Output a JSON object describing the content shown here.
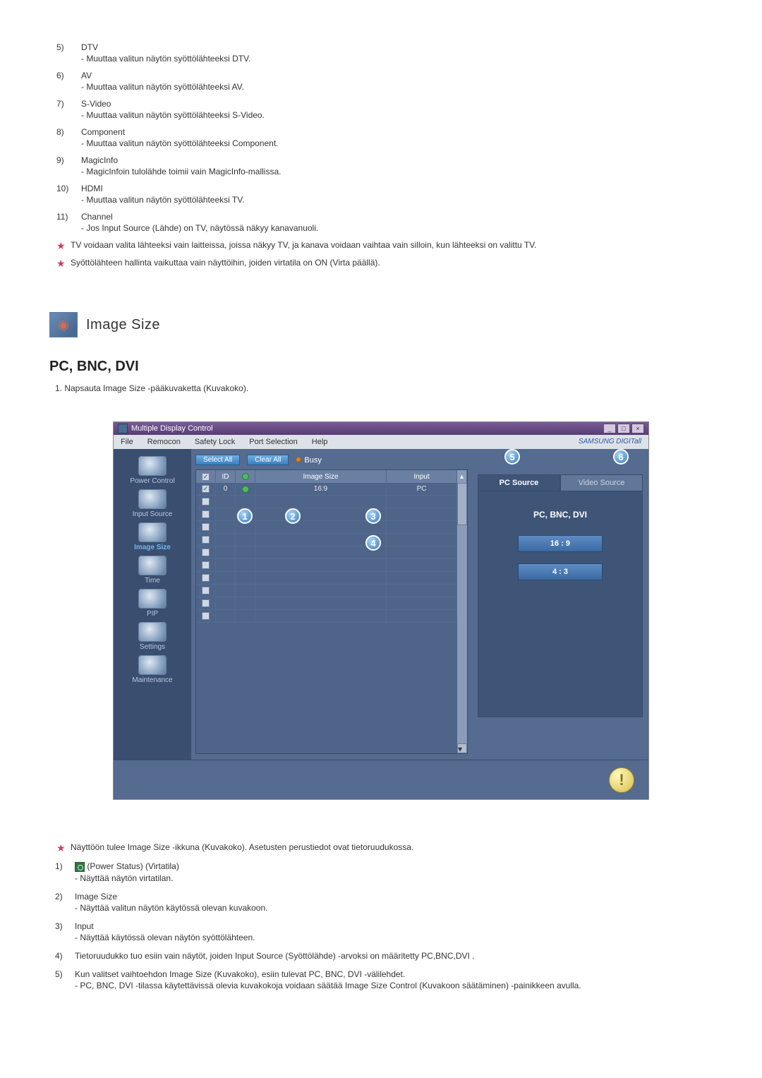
{
  "top_list": [
    {
      "num": "5)",
      "title": "DTV",
      "desc": [
        "- Muuttaa valitun näytön syöttölähteeksi DTV."
      ]
    },
    {
      "num": "6)",
      "title": "AV",
      "desc": [
        "- Muuttaa valitun näytön syöttölähteeksi AV."
      ]
    },
    {
      "num": "7)",
      "title": "S-Video",
      "desc": [
        "- Muuttaa valitun näytön syöttölähteeksi S-Video."
      ]
    },
    {
      "num": "8)",
      "title": "Component",
      "desc": [
        "- Muuttaa valitun näytön syöttölähteeksi Component."
      ]
    },
    {
      "num": "9)",
      "title": "MagicInfo",
      "desc": [
        "- MagicInfoin tulolähde toimii vain MagicInfo-mallissa."
      ]
    },
    {
      "num": "10)",
      "title": "HDMI",
      "desc": [
        "- Muuttaa valitun näytön syöttölähteeksi TV."
      ]
    },
    {
      "num": "11)",
      "title": "Channel",
      "desc": [
        "- Jos Input Source (Lähde) on TV, näytössä näkyy kanavanuoli."
      ]
    }
  ],
  "star_notes_top": [
    "TV voidaan valita lähteeksi vain laitteissa, joissa näkyy TV, ja kanava voidaan vaihtaa vain silloin, kun lähteeksi on valittu TV.",
    "Syöttölähteen hallinta vaikuttaa vain näyttöihin, joiden virtatila on ON (Virta päällä)."
  ],
  "section_title": "Image Size",
  "sub_title": "PC, BNC, DVI",
  "sub_instruction": "1. Napsauta Image Size -pääkuvaketta (Kuvakoko).",
  "app": {
    "title": "Multiple Display Control",
    "menu": [
      "File",
      "Remocon",
      "Safety Lock",
      "Port Selection",
      "Help"
    ],
    "brand": "SAMSUNG DIGITall",
    "sidebar": [
      {
        "label": "Power Control"
      },
      {
        "label": "Input Source"
      },
      {
        "label": "Image Size"
      },
      {
        "label": "Time"
      },
      {
        "label": "PIP"
      },
      {
        "label": "Settings"
      },
      {
        "label": "Maintenance"
      }
    ],
    "buttons": {
      "select_all": "Select All",
      "clear_all": "Clear All",
      "busy": "Busy"
    },
    "grid": {
      "headers": {
        "chk": "✓",
        "id": "ID",
        "st": "",
        "size": "Image Size",
        "input": "Input"
      },
      "row": {
        "id": "0",
        "size": "16:9",
        "input": "PC"
      }
    },
    "right": {
      "tab_pc": "PC Source",
      "tab_video": "Video Source",
      "panel_label": "PC, BNC, DVI",
      "ratios": [
        "16 : 9",
        "4 : 3"
      ]
    },
    "markers": {
      "m1": "1",
      "m2": "2",
      "m3": "3",
      "m4": "4",
      "m5": "5",
      "m6": "6"
    }
  },
  "star_notes_mid": [
    "Näyttöön tulee Image Size -ikkuna (Kuvakoko). Asetusten perustiedot ovat tietoruudukossa."
  ],
  "bottom_list": [
    {
      "num": "1)",
      "icon": true,
      "title": "(Power Status) (Virtatila)",
      "desc": [
        "- Näyttää näytön virtatilan."
      ]
    },
    {
      "num": "2)",
      "title": "Image Size",
      "desc": [
        "- Näyttää valitun näytön käytössä olevan kuvakoon."
      ]
    },
    {
      "num": "3)",
      "title": "Input",
      "desc": [
        "- Näyttää käytössä olevan näytön syöttölähteen."
      ]
    },
    {
      "num": "4)",
      "title": "Tietoruudukko tuo esiin vain näytöt, joiden Input Source (Syöttölähde) -arvoksi on määritetty PC,BNC,DVI .",
      "desc": []
    },
    {
      "num": "5)",
      "title": "Kun valitset vaihtoehdon Image Size (Kuvakoko), esiin tulevat PC, BNC, DVI -välilehdet.",
      "desc": [
        "- PC, BNC, DVI -tilassa käytettävissä olevia kuvakokoja voidaan säätää Image Size Control (Kuvakoon säätäminen) -painikkeen avulla."
      ]
    }
  ]
}
